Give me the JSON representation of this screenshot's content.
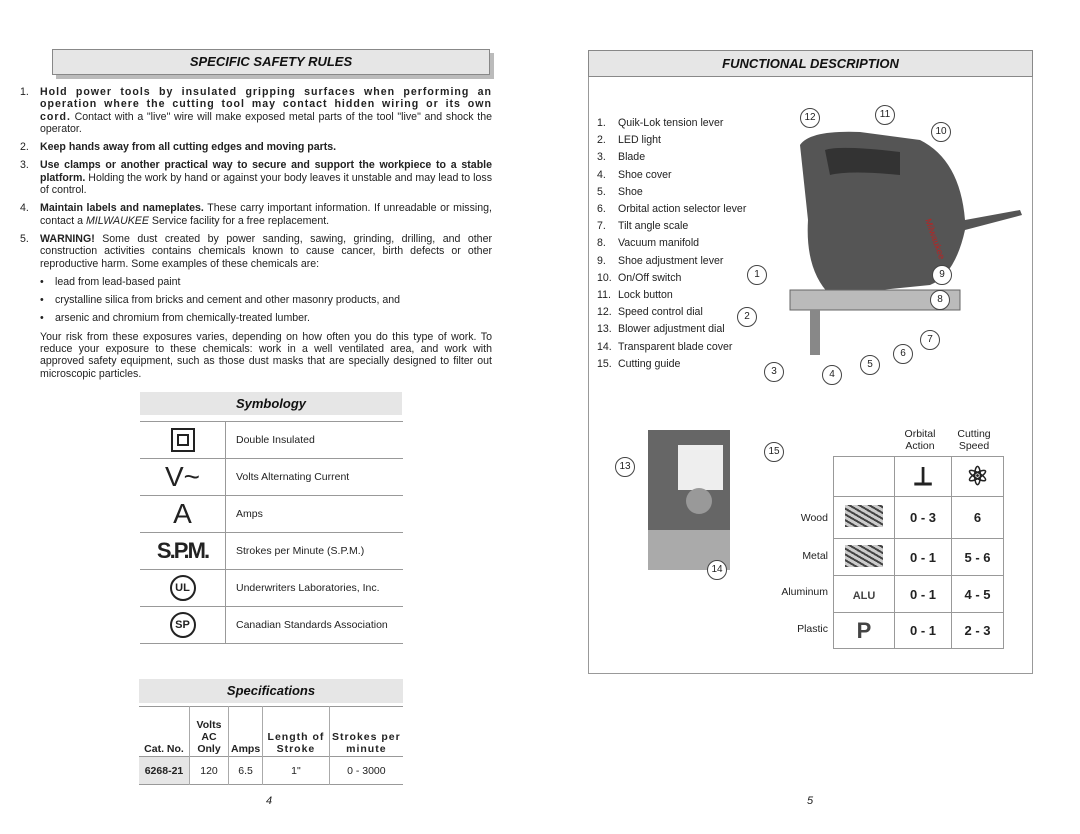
{
  "left": {
    "title": "SPECIFIC SAFETY RULES",
    "rules": [
      {
        "n": "1.",
        "bold": "Hold power tools by insulated gripping surfaces when performing an operation where the cutting tool may contact hidden wiring or its own cord.",
        "text": " Contact with a \"live\" wire will make exposed metal parts of the tool \"live\" and shock the operator."
      },
      {
        "n": "2.",
        "bold": "Keep hands away from all cutting edges and moving parts.",
        "text": ""
      },
      {
        "n": "3.",
        "bold": "Use clamps or another practical way to secure and support the workpiece to a stable platform.",
        "text": " Holding the work by hand or against your body leaves it unstable and may lead to loss of control."
      },
      {
        "n": "4.",
        "bold": "Maintain labels and nameplates.",
        "text": " These carry important information. If unreadable or missing, contact a ",
        "italic": "MILWAUKEE",
        "text2": " Service facility for a free replacement."
      },
      {
        "n": "5.",
        "bold": "WARNING!",
        "text": " Some dust created by power sanding, sawing, grinding, drilling, and other construction activities contains chemicals known to cause cancer, birth defects or other reproductive harm. Some examples of these chemicals are:"
      }
    ],
    "bullets": [
      "lead from lead-based paint",
      "crystalline silica from bricks and cement and other masonry products, and",
      "arsenic and chromium from chemically-treated lumber."
    ],
    "closing": "Your risk from these exposures varies, depending on how often you do this type of work. To reduce your exposure to these chemicals: work in a well ventilated area, and work with approved safety equipment, such as those dust masks that are specially designed to filter out microscopic particles.",
    "symbology": {
      "title": "Symbology",
      "items": [
        {
          "icon": "double-insulated-icon",
          "symbol": "",
          "label": "Double Insulated"
        },
        {
          "icon": "volts-ac-icon",
          "symbol": "V~",
          "label": "Volts Alternating Current"
        },
        {
          "icon": "amps-icon",
          "symbol": "A",
          "label": "Amps"
        },
        {
          "icon": "spm-icon",
          "symbol": "S.P.M.",
          "label": "Strokes per Minute (S.P.M.)"
        },
        {
          "icon": "ul-icon",
          "symbol": "UL",
          "label": "Underwriters Laboratories, Inc."
        },
        {
          "icon": "csa-icon",
          "symbol": "SP",
          "label": "Canadian Standards Association"
        }
      ]
    },
    "specs": {
      "title": "Specifications",
      "headers": [
        "Cat. No.",
        "Volts AC Only",
        "Amps",
        "Length of Stroke",
        "Strokes per minute"
      ],
      "row": [
        "6268-21",
        "120",
        "6.5",
        "1\"",
        "0 - 3000"
      ]
    },
    "page": "4"
  },
  "right": {
    "title": "FUNCTIONAL DESCRIPTION",
    "items": [
      "Quik-Lok tension lever",
      "LED light",
      "Blade",
      "Shoe cover",
      "Shoe",
      "Orbital action selector lever",
      "Tilt angle scale",
      "Vacuum manifold",
      "Shoe adjustment lever",
      "On/Off switch",
      "Lock button",
      "Speed control dial",
      "Blower adjustment dial",
      "Transparent blade cover",
      "Cutting guide"
    ],
    "callouts": [
      "1",
      "2",
      "3",
      "4",
      "5",
      "6",
      "7",
      "8",
      "9",
      "10",
      "11",
      "12",
      "13",
      "14",
      "15"
    ],
    "table": {
      "headers": [
        "Orbital Action",
        "Cutting Speed"
      ],
      "rows": [
        {
          "material": "Wood",
          "icon": "wood-icon",
          "orbital": "0 - 3",
          "speed": "6"
        },
        {
          "material": "Metal",
          "icon": "metal-beam-icon",
          "orbital": "0 - 1",
          "speed": "5 - 6"
        },
        {
          "material": "Aluminum",
          "icon": "aluminum-icon",
          "badge": "ALU",
          "orbital": "0 - 1",
          "speed": "4 - 5"
        },
        {
          "material": "Plastic",
          "icon": "plastic-icon",
          "badge": "P",
          "orbital": "0 - 1",
          "speed": "2 - 3"
        }
      ]
    },
    "page": "5"
  }
}
